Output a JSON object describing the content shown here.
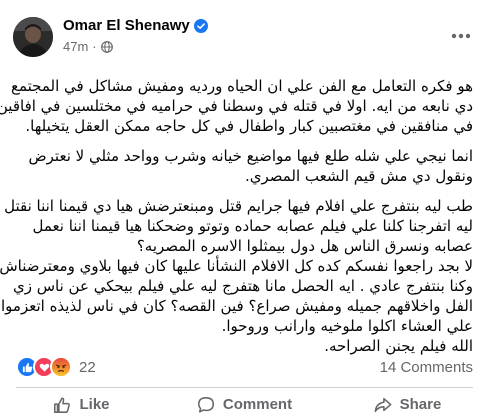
{
  "author": {
    "name": "Omar El Shenawy",
    "verified": true,
    "time": "47m",
    "privacy_icon": "globe-icon"
  },
  "post_text": {
    "para1": [
      "هو فكره التعامل مع الفن علي ان الحياه ورديه ومفيش مشاكل في المجتمع",
      "دي نابعه من ايه. اولا في قتله في وسطنا في حراميه في مختلسين في افاقين",
      "في منافقين في مغتصبين كبار واطفال في كل حاجه ممكن العقل يتخيلها."
    ],
    "para2": [
      "انما نيجي علي شله طلع فيها مواضيع خيانه وشرب وواحد مثلي لا نعترض",
      "ونقول دي مش قيم الشعب المصري."
    ],
    "para3": [
      "طب ليه بنتفرج علي افلام فيها جرايم قتل ومبنعترضش هيا دي قيمنا اننا نقتل",
      "ليه اتفرجنا كلنا علي فيلم عصابه حماده وتوتو وضحكنا هيا قيمنا اننا نعمل",
      "عصابه ونسرق الناس هل دول بيمثلوا الاسره المصريه؟",
      "لا بجد راجعوا نفسكم كده كل الافلام النشأنا عليها كان فيها بلاوي ومعترضناش",
      "وكنا بنتفرج عادي . ايه الحصل مانا هتفرج ليه علي فيلم بيحكي عن ناس زي",
      "الفل واخلاقهم جميله ومفيش صراع؟ فين القصه؟ كان في ناس لذيذه اتعزموا",
      "علي العشاء اكلوا ملوخيه وارانب وروحوا.",
      "الله فيلم يجنن الصراحه."
    ]
  },
  "reactions": {
    "icons": [
      "like-reaction-icon",
      "love-reaction-icon",
      "angry-reaction-icon"
    ],
    "count": "22",
    "comments": "14 Comments"
  },
  "actions": {
    "like": "Like",
    "comment": "Comment",
    "share": "Share"
  },
  "colors": {
    "text": "#050505",
    "muted": "#65676b",
    "verified_blue": "#1877f2",
    "divider": "#ced0d4"
  }
}
